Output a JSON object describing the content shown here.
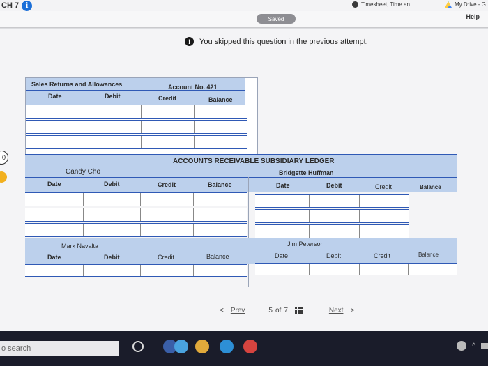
{
  "browser": {
    "tab_label": "CH 7",
    "bookmarks": [
      "Timesheet, Time an...",
      "My Drive - G"
    ]
  },
  "header": {
    "saved_label": "Saved",
    "help_label": "Help"
  },
  "notice": {
    "text": "You skipped this question in the previous attempt."
  },
  "ledger_top": {
    "title": "Sales Returns and Allowances",
    "account_no": "Account No. 421",
    "columns": [
      "Date",
      "Debit",
      "Credit",
      "Balance"
    ]
  },
  "ar_ledger": {
    "title": "ACCOUNTS RECEIVABLE SUBSIDIARY LEDGER",
    "accounts": [
      {
        "name": "Candy Cho",
        "columns": [
          "Date",
          "Debit",
          "Credit",
          "Balance"
        ]
      },
      {
        "name": "Bridgette Huffman",
        "columns": [
          "Date",
          "Debit",
          "Credit",
          "Balance"
        ]
      },
      {
        "name": "Mark Navalta",
        "columns": [
          "Date",
          "Debit",
          "Credit",
          "Balance"
        ]
      },
      {
        "name": "Jim Peterson",
        "columns": [
          "Date",
          "Debit",
          "Credit",
          "Balance"
        ]
      }
    ]
  },
  "pager": {
    "prev": "Prev",
    "current": "5",
    "of_label": "of",
    "total": "7",
    "next": "Next"
  },
  "taskbar": {
    "search_label": "o search"
  },
  "side": {
    "number": "0"
  }
}
